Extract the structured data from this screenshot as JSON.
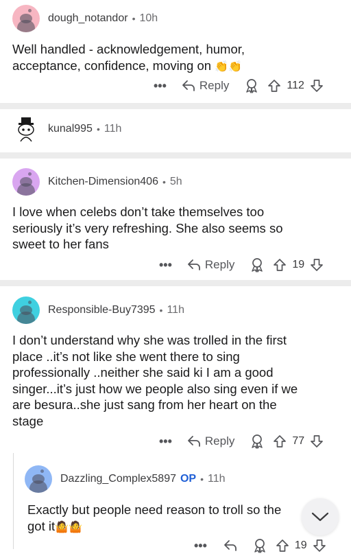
{
  "comments": [
    {
      "username": "dough_notandor",
      "time": "10h",
      "text": [
        "Well handled - acknowledgement, humor,",
        "acceptance, confidence, moving on"
      ],
      "emoji": "👏👏",
      "reply_label": "Reply",
      "votes": "112",
      "avatar_color": "#f7b6c2"
    },
    {
      "username": "kunal995",
      "time": "11h"
    },
    {
      "username": "Kitchen-Dimension406",
      "time": "5h",
      "text": [
        "I love when celebs don’t take themselves too",
        "seriously it’s very refreshing. She also seems so",
        "sweet to her fans"
      ],
      "reply_label": "Reply",
      "votes": "19",
      "avatar_color": "#d9a6f0"
    },
    {
      "username": "Responsible-Buy7395",
      "time": "11h",
      "text": [
        "I don’t understand why she was trolled in the first",
        "place ..it’s not like she went there to sing",
        "professionally ..neither she said ki I am a good",
        "singer...it’s just how we people also sing even if we",
        "are besura..she just sang from her heart on the",
        "stage"
      ],
      "reply_label": "Reply",
      "votes": "77",
      "avatar_color": "#3fd0e0"
    },
    {
      "username": "Dazzling_Complex5897",
      "badge": "OP",
      "time": "11h",
      "text": [
        "Exactly but people need reason to troll so the",
        "got it"
      ],
      "emoji": "🤷🤷",
      "votes": "19",
      "avatar_color": "#8fb7f5"
    }
  ],
  "separator_dot": "•",
  "more_label": "•••"
}
